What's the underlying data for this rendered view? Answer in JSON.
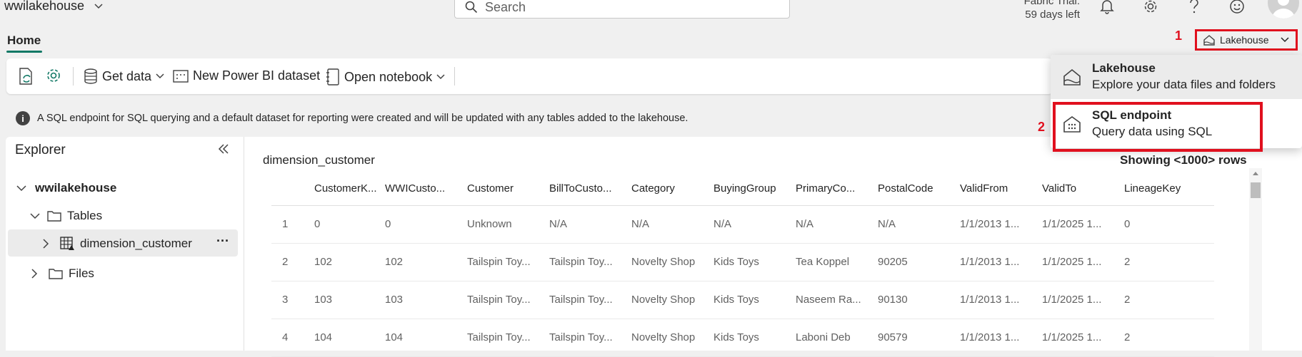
{
  "topbar": {
    "workspace": "wwilakehouse",
    "search_placeholder": "Search",
    "trial_line1": "Fabric Trial:",
    "trial_line2": "59 days left",
    "icons": [
      "bell-icon",
      "gear-icon",
      "help-icon",
      "smiley-icon",
      "avatar"
    ]
  },
  "tabs": {
    "home": "Home"
  },
  "ribbon": {
    "get_data": "Get data",
    "new_dataset": "New Power BI dataset",
    "open_notebook": "Open notebook"
  },
  "info": {
    "message": "A SQL endpoint for SQL querying and a default dataset for reporting were created and will be updated with any tables added to the lakehouse."
  },
  "mode_switch": {
    "label": "Lakehouse",
    "callout_1": "1",
    "callout_2": "2"
  },
  "dropdown": {
    "items": [
      {
        "title": "Lakehouse",
        "subtitle": "Explore your data files and folders"
      },
      {
        "title": "SQL endpoint",
        "subtitle": "Query data using SQL"
      }
    ]
  },
  "explorer": {
    "title": "Explorer",
    "root": "wwilakehouse",
    "tables": "Tables",
    "table_item": "dimension_customer",
    "more": "···",
    "files": "Files"
  },
  "main": {
    "table_title": "dimension_customer",
    "showing": "Showing <1000> rows",
    "columns": [
      "",
      "CustomerK...",
      "WWICusto...",
      "Customer",
      "BillToCusto...",
      "Category",
      "BuyingGroup",
      "PrimaryCo...",
      "PostalCode",
      "ValidFrom",
      "ValidTo",
      "LineageKey"
    ],
    "rows": [
      [
        "1",
        "0",
        "0",
        "Unknown",
        "N/A",
        "N/A",
        "N/A",
        "N/A",
        "N/A",
        "1/1/2013 1...",
        "1/1/2025 1...",
        "0"
      ],
      [
        "2",
        "102",
        "102",
        "Tailspin Toy...",
        "Tailspin Toy...",
        "Novelty Shop",
        "Kids Toys",
        "Tea Koppel",
        "90205",
        "1/1/2013 1...",
        "1/1/2025 1...",
        "2"
      ],
      [
        "3",
        "103",
        "103",
        "Tailspin Toy...",
        "Tailspin Toy...",
        "Novelty Shop",
        "Kids Toys",
        "Naseem Ra...",
        "90130",
        "1/1/2013 1...",
        "1/1/2025 1...",
        "2"
      ],
      [
        "4",
        "104",
        "104",
        "Tailspin Toy...",
        "Tailspin Toy...",
        "Novelty Shop",
        "Kids Toys",
        "Laboni Deb",
        "90579",
        "1/1/2013 1...",
        "1/1/2025 1...",
        "2"
      ]
    ]
  },
  "colors": {
    "accent": "#117865",
    "highlight_red": "#e0101e"
  }
}
